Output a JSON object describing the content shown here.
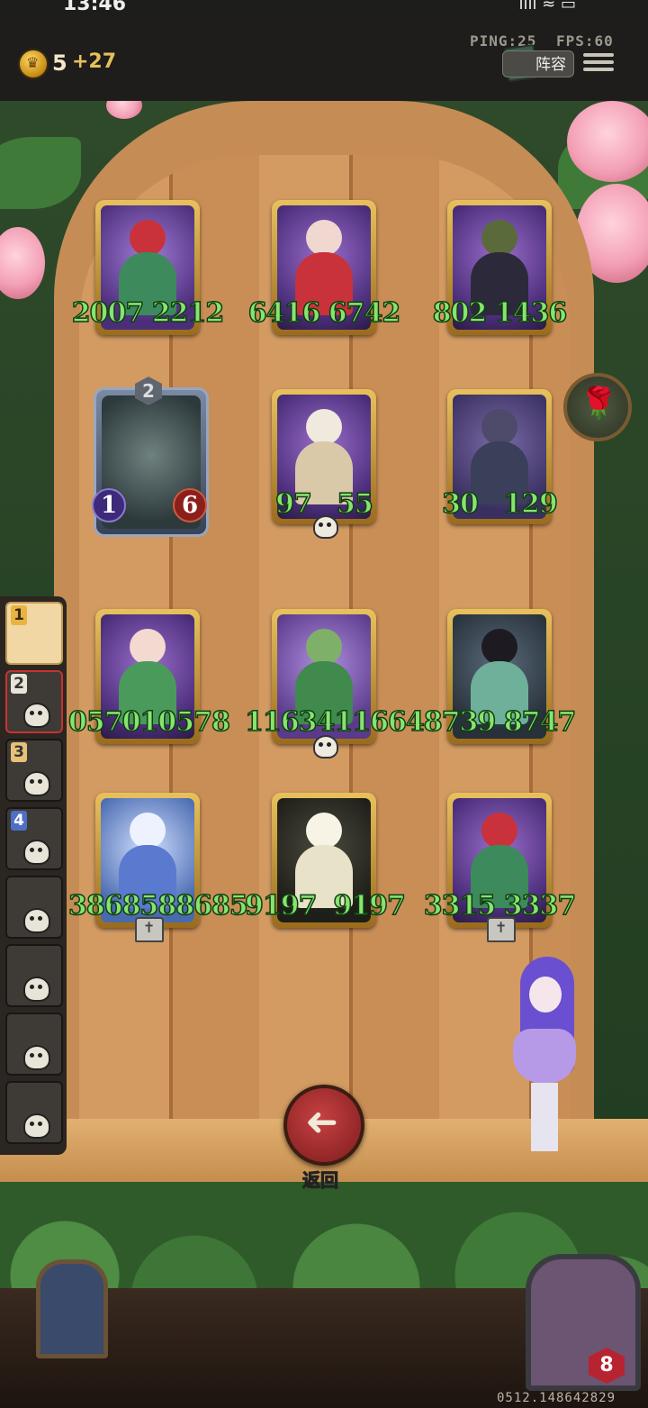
{
  "status": {
    "time": "13:46",
    "signal": "ıııl ≈ ▭"
  },
  "perf": {
    "ping": "PING:25",
    "fps": "FPS:60"
  },
  "gold": {
    "amount": "5",
    "increment": "+27"
  },
  "header": {
    "lineup_label": "阵容"
  },
  "cards": [
    {
      "attack": "2007",
      "health": "2212"
    },
    {
      "attack": "6416",
      "health": "6742"
    },
    {
      "attack": "802",
      "health": "1436"
    },
    {
      "attack": "97",
      "health": "55"
    },
    {
      "attack": "30",
      "health": "129"
    },
    {
      "attack": "057010578",
      "health": ""
    },
    {
      "attack": "1163411664",
      "health": ""
    },
    {
      "attack": "8739",
      "health": "8747"
    },
    {
      "attack": "3868588685",
      "health": ""
    },
    {
      "attack": "9197",
      "health": "9197"
    },
    {
      "attack": "3315",
      "health": "3337"
    }
  ],
  "special_card": {
    "tier": "2",
    "attack": "1",
    "health": "6"
  },
  "rail": {
    "numbers": [
      "1",
      "2",
      "3",
      "4"
    ]
  },
  "back": {
    "label": "返回"
  },
  "bottom_right": {
    "level": "8"
  },
  "uid": "0512.148642829",
  "colors": {
    "stat_green": "#86e46f",
    "back_red": "#b5312f",
    "door_wood": "#c58d55"
  }
}
